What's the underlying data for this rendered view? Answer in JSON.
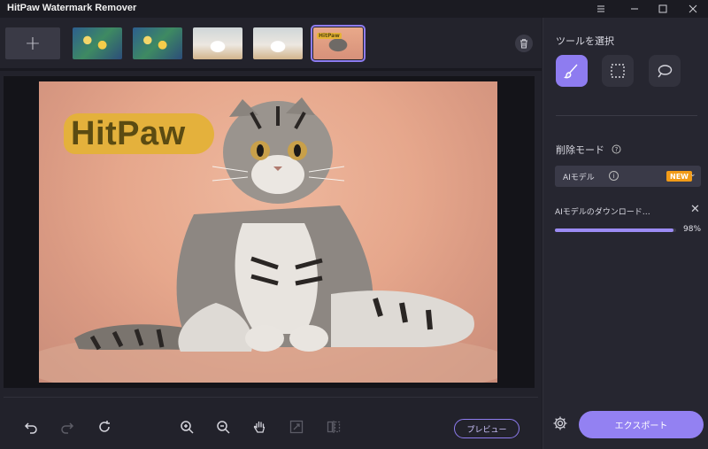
{
  "window": {
    "title": "HitPaw Watermark Remover",
    "controls": [
      "menu-icon",
      "minimize-icon",
      "maximize-icon",
      "close-icon"
    ]
  },
  "thumbnails": {
    "add_label": "+",
    "items": [
      {
        "kind": "flower",
        "selected": false
      },
      {
        "kind": "flower",
        "selected": false
      },
      {
        "kind": "arch",
        "selected": false
      },
      {
        "kind": "arch",
        "selected": false
      },
      {
        "kind": "cat",
        "selected": true,
        "watermark": "HitPaw"
      }
    ]
  },
  "canvas": {
    "watermark_text": "HitPaw"
  },
  "bottom_toolbar": {
    "tools": [
      "undo-icon",
      "redo-icon",
      "reset-icon",
      "zoom-in-icon",
      "zoom-out-icon",
      "hand-icon",
      "fit-icon",
      "compare-icon"
    ],
    "preview_label": "プレビュー"
  },
  "panel": {
    "tool_section_title": "ツールを選択",
    "tools": [
      {
        "name": "brush-icon",
        "active": true
      },
      {
        "name": "rect-select-icon",
        "active": false
      },
      {
        "name": "lasso-icon",
        "active": false
      }
    ],
    "mode_title": "削除モード",
    "mode_select": {
      "value": "AIモデル",
      "badge": "NEW"
    },
    "download": {
      "text": "AIモデルのダウンロード…",
      "percent_label": "98%",
      "progress": 0.98
    },
    "export_label": "エクスポート"
  },
  "colors": {
    "accent": "#9381f2",
    "badge": "#f29b17",
    "background": "#1e1e26",
    "watermark": "#e4b13c"
  }
}
